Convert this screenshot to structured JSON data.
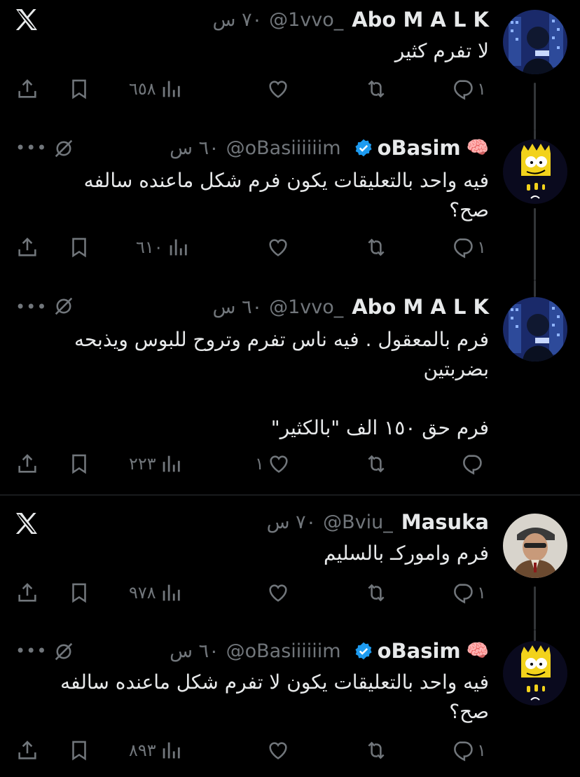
{
  "tweets": [
    {
      "name": "Abo M A L K",
      "handle": "@1vvo_",
      "time": "٧٠ س",
      "body": "لا تفرم كثير",
      "views": "٦٥٨",
      "likes": "",
      "retweets": "",
      "replies": "١",
      "corner_icon": "x-logo-icon"
    },
    {
      "name": "oBasim",
      "handle": "@oBasiiiiiim",
      "time": "٦٠ س",
      "body": "فيه واحد بالتعليقات يكون فرم شكل ماعنده سالفه\nصح؟",
      "views": "٦١٠",
      "likes": "",
      "retweets": "",
      "replies": "١",
      "corner_icon": "more-icon"
    },
    {
      "name": "Abo M A L K",
      "handle": "@1vvo_",
      "time": "٦٠ س",
      "body": "فرم بالمعقول . فيه ناس تفرم وتروح للبوس ويذبحه\nبضربتين\n\nفرم حق ١٥٠ الف \"بالكثير\"",
      "views": "٢٢٣",
      "likes": "١",
      "retweets": "",
      "replies": "",
      "corner_icon": "more-icon"
    },
    {
      "name": "Masuka",
      "handle": "@Bviu_",
      "time": "٧٠ س",
      "body": "فرم واموركـ بالسليم",
      "views": "٩٧٨",
      "likes": "",
      "retweets": "",
      "replies": "١",
      "corner_icon": "x-logo-icon"
    },
    {
      "name": "oBasim",
      "handle": "@oBasiiiiiim",
      "time": "٦٠ س",
      "body": "فيه واحد بالتعليقات يكون لا تفرم شكل ماعنده سالفه\nصح؟",
      "views": "٨٩٣",
      "likes": "",
      "retweets": "",
      "replies": "١",
      "corner_icon": "more-icon"
    }
  ],
  "more_label": "•••",
  "colors": {
    "bg": "#000000",
    "text": "#e7e9ea",
    "muted": "#71767b",
    "verified": "#1d9bf0"
  }
}
